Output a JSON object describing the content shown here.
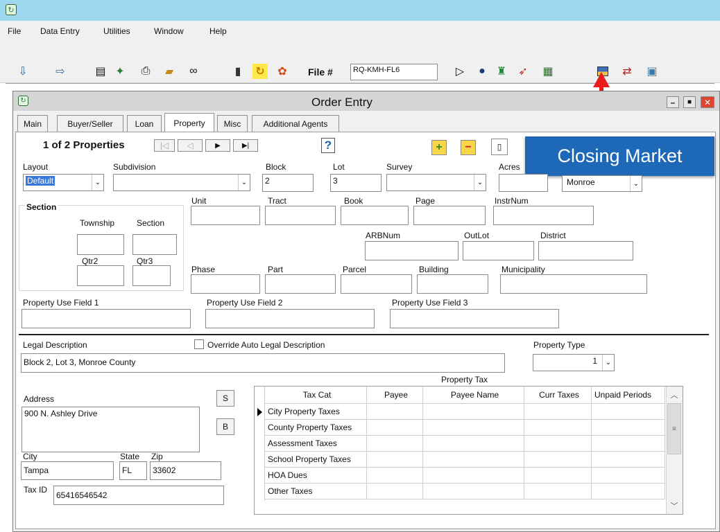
{
  "menu": [
    "File",
    "Data Entry",
    "Utilities",
    "Window",
    "Help"
  ],
  "toolbar": {
    "file_label": "File #",
    "file_value": "RQ-KMH-FL6"
  },
  "icons": [
    "import-icon",
    "export-icon",
    "document-icon",
    "map-icon",
    "print-icon",
    "folder-icon",
    "binoculars-icon",
    "chart-icon",
    "refresh-icon",
    "settings-icon",
    "arrow-right-icon",
    "globe-icon",
    "person-icon",
    "pin-icon",
    "calculator-icon",
    "closing-market-icon",
    "transfer-icon",
    "image-icon"
  ],
  "window": {
    "title": "Order Entry"
  },
  "tabs": [
    "Main",
    "Buyer/Seller",
    "Loan",
    "Property",
    "Misc",
    "Additional Agents"
  ],
  "callout": "Closing Market",
  "property": {
    "nav_text": "1 of 2 Properties",
    "labels": {
      "layout": "Layout",
      "subdivision": "Subdivision",
      "block": "Block",
      "lot": "Lot",
      "survey": "Survey",
      "acres": "Acres",
      "unit": "Unit",
      "tract": "Tract",
      "book": "Book",
      "page": "Page",
      "instrnum": "InstrNum",
      "section_group": "Section",
      "township": "Township",
      "section": "Section",
      "qtr2": "Qtr2",
      "qtr3": "Qtr3",
      "arbnum": "ARBNum",
      "outlot": "OutLot",
      "district": "District",
      "phase": "Phase",
      "part": "Part",
      "parcel": "Parcel",
      "building": "Building",
      "municipality": "Municipality",
      "use1": "Property Use Field 1",
      "use2": "Property Use Field 2",
      "use3": "Property Use Field 3"
    },
    "layout_value": "Default",
    "block_value": "2",
    "lot_value": "3",
    "county_value": "Monroe"
  },
  "legal": {
    "label": "Legal Description",
    "override_label": "Override Auto Legal Description",
    "value": "Block 2, Lot 3, Monroe County",
    "property_type_label": "Property Type",
    "property_type_value": "1"
  },
  "address": {
    "label": "Address",
    "value": "900 N. Ashley Drive",
    "city_label": "City",
    "state_label": "State",
    "zip_label": "Zip",
    "city": "Tampa",
    "state": "FL",
    "zip": "33602",
    "taxid_label": "Tax ID",
    "taxid": "65416546542",
    "s_btn": "S",
    "b_btn": "B"
  },
  "tax": {
    "title": "Property Tax",
    "columns": [
      "Tax Cat",
      "Payee",
      "Payee Name",
      "Curr Taxes",
      "Unpaid Periods"
    ],
    "rows": [
      "City Property Taxes",
      "County Property Taxes",
      "Assessment Taxes",
      "School Property Taxes",
      "HOA Dues",
      "Other Taxes"
    ]
  }
}
